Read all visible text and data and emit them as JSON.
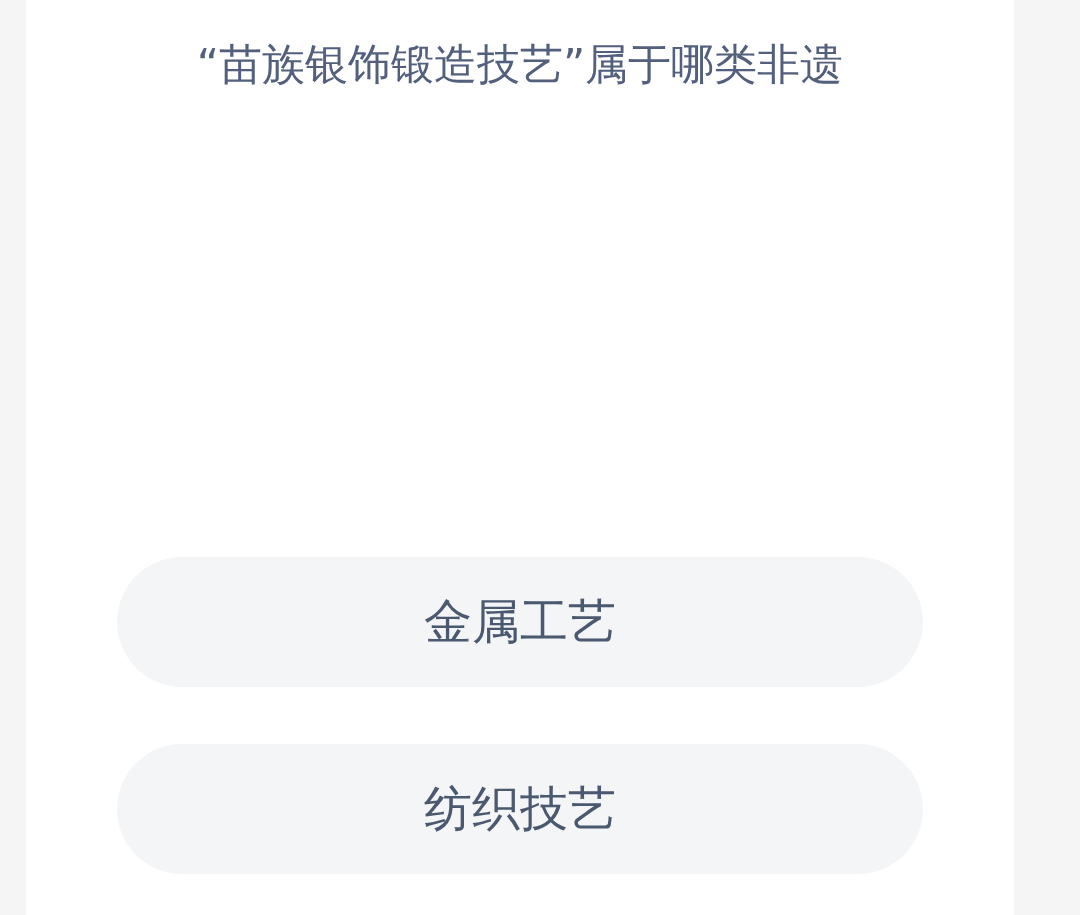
{
  "question": "“苗族银饰锻造技艺”属于哪类非遗",
  "options": [
    {
      "label": "金属工艺"
    },
    {
      "label": "纺织技艺"
    }
  ]
}
